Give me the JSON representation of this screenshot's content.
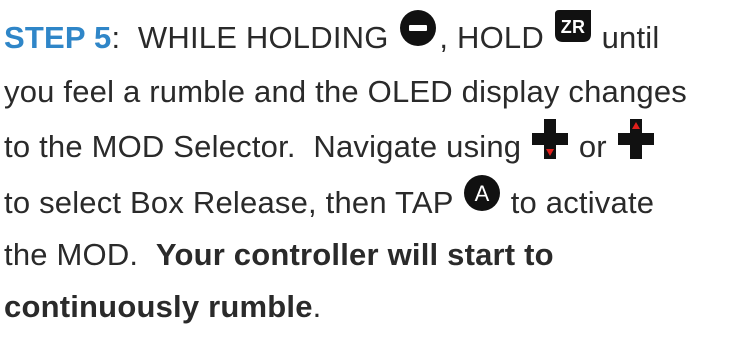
{
  "line1": {
    "step_label": "STEP 5",
    "colon": ":",
    "text_a": "  WHILE HOLDING ",
    "text_b": ", HOLD ",
    "text_c": " until"
  },
  "line2": {
    "text": "you feel a rumble and the OLED display changes"
  },
  "line3": {
    "text_a": "to the MOD Selector.  Navigate using ",
    "text_b": " or "
  },
  "line4": {
    "text_a": "to select Box Release, then TAP ",
    "text_b": " to activate"
  },
  "line5": {
    "text_a": "the MOD.  ",
    "bold": "Your controller will start to"
  },
  "line6": {
    "bold": "continuously rumble",
    "text_a": "."
  },
  "icons": {
    "minus": {
      "name": "minus-button-icon",
      "color": "#111111"
    },
    "zr": {
      "name": "zr-button-icon",
      "label": "ZR",
      "color": "#111111"
    },
    "dpad_down": {
      "name": "dpad-down-icon",
      "color": "#111111",
      "arrow_color": "#e0201c"
    },
    "dpad_up": {
      "name": "dpad-up-icon",
      "color": "#111111",
      "arrow_color": "#e0201c"
    },
    "a": {
      "name": "a-button-icon",
      "label": "A",
      "color": "#111111"
    }
  }
}
